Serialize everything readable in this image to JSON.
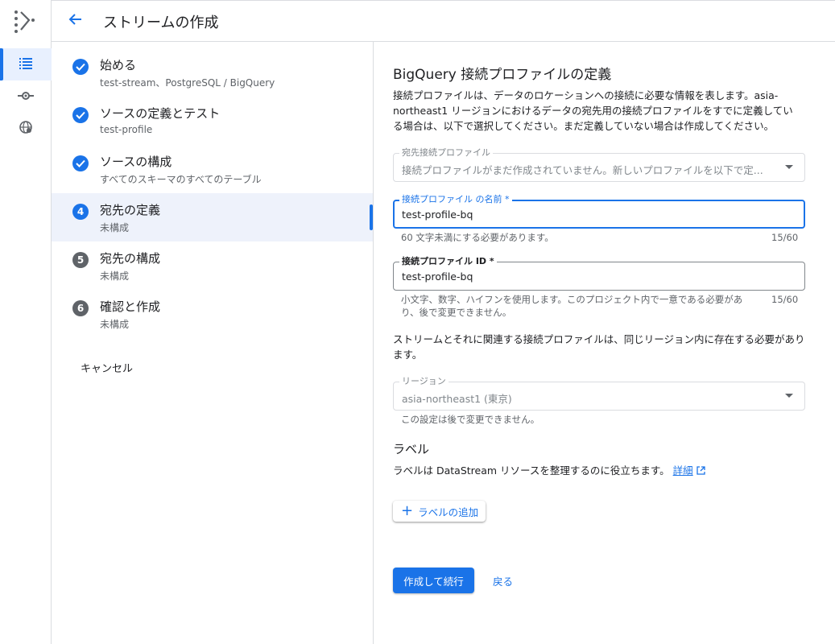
{
  "header": {
    "title": "ストリームの作成"
  },
  "rail": {
    "items": [
      {
        "icon": "list-icon",
        "active": true
      },
      {
        "icon": "stream-icon",
        "active": false
      },
      {
        "icon": "globe-icon",
        "active": false
      }
    ]
  },
  "steps": [
    {
      "number": "1",
      "state": "done",
      "label": "始める",
      "sub": "test-stream、PostgreSQL / BigQuery"
    },
    {
      "number": "2",
      "state": "done",
      "label": "ソースの定義とテスト",
      "sub": "test-profile"
    },
    {
      "number": "3",
      "state": "done",
      "label": "ソースの構成",
      "sub": "すべてのスキーマのすべてのテーブル"
    },
    {
      "number": "4",
      "state": "current",
      "label": "宛先の定義",
      "sub": "未構成"
    },
    {
      "number": "5",
      "state": "pending",
      "label": "宛先の構成",
      "sub": "未構成"
    },
    {
      "number": "6",
      "state": "pending",
      "label": "確認と作成",
      "sub": "未構成"
    }
  ],
  "cancel_label": "キャンセル",
  "form": {
    "title": "BigQuery 接続プロファイルの定義",
    "description": "接続プロファイルは、データのロケーションへの接続に必要な情報を表します。asia-northeast1 リージョンにおけるデータの宛先用の接続プロファイルをすでに定義している場合は、以下で選択してください。まだ定義していない場合は作成してください。",
    "dest_profile": {
      "label": "宛先接続プロファイル",
      "value": "接続プロファイルがまだ作成されていません。新しいプロファイルを以下で定..."
    },
    "profile_name": {
      "label": "接続プロファイル の名前 *",
      "value": "test-profile-bq",
      "hint": "60 文字未満にする必要があります。",
      "counter": "15/60"
    },
    "profile_id": {
      "label": "接続プロファイル ID *",
      "value": "test-profile-bq",
      "hint": "小文字、数字、ハイフンを使用します。このプロジェクト内で一意である必要があり、後で変更できません。",
      "counter": "15/60"
    },
    "region_note": "ストリームとそれに関連する接続プロファイルは、同じリージョン内に存在する必要があります。",
    "region": {
      "label": "リージョン",
      "value": "asia-northeast1 (東京)",
      "hint": "この設定は後で変更できません。"
    },
    "labels_title": "ラベル",
    "labels_desc": "ラベルは DataStream リソースを整理するのに役立ちます。",
    "labels_link": "詳細",
    "add_label": "ラベルの追加",
    "submit": "作成して続行",
    "back": "戻る"
  },
  "colors": {
    "accent": "#1a73e8",
    "pending_step": "#5f6368",
    "active_bg": "#eef2fb"
  }
}
